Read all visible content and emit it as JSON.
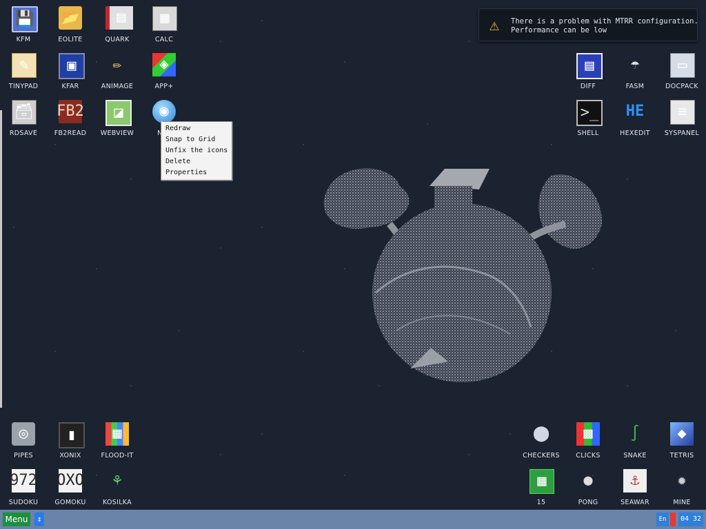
{
  "desktop": {
    "icons": [
      {
        "label": "KFM",
        "glyph": "💾"
      },
      {
        "label": "EOLITE",
        "glyph": "📂"
      },
      {
        "label": "QUARK",
        "glyph": "▤"
      },
      {
        "label": "CALC",
        "glyph": "▦"
      },
      {
        "label": "TINYPAD",
        "glyph": "✎"
      },
      {
        "label": "KFAR",
        "glyph": "▣"
      },
      {
        "label": "ANIMAGE",
        "glyph": "✏"
      },
      {
        "label": "APP+",
        "glyph": "◈"
      },
      {
        "label": "RDSAVE",
        "glyph": "🗃"
      },
      {
        "label": "FB2READ",
        "glyph": "FB2"
      },
      {
        "label": "WEBVIEW",
        "glyph": "◪"
      },
      {
        "label": "NET",
        "glyph": "◉"
      },
      {
        "label": "DIFF",
        "glyph": "▤"
      },
      {
        "label": "FASM",
        "glyph": "☂"
      },
      {
        "label": "DOCPACK",
        "glyph": "▭"
      },
      {
        "label": "SHELL",
        "glyph": ">_"
      },
      {
        "label": "HEXEDIT",
        "glyph": "HE"
      },
      {
        "label": "SYSPANEL",
        "glyph": "≡"
      },
      {
        "label": "PIPES",
        "glyph": "◎"
      },
      {
        "label": "XONIX",
        "glyph": "▮"
      },
      {
        "label": "FLOOD-IT",
        "glyph": "▦"
      },
      {
        "label": "CHECKERS",
        "glyph": "⬤"
      },
      {
        "label": "CLICKS",
        "glyph": "▩"
      },
      {
        "label": "SNAKE",
        "glyph": "∫"
      },
      {
        "label": "TETRIS",
        "glyph": "◆"
      },
      {
        "label": "SUDOKU",
        "glyph": "972"
      },
      {
        "label": "GOMOKU",
        "glyph": "OXO"
      },
      {
        "label": "KOSILKA",
        "glyph": "⚘"
      },
      {
        "label": "15",
        "glyph": "▦"
      },
      {
        "label": "PONG",
        "glyph": "●"
      },
      {
        "label": "SEAWAR",
        "glyph": "⚓"
      },
      {
        "label": "MINE",
        "glyph": "✹"
      }
    ],
    "wallpaper": "planet-illustration"
  },
  "notification": {
    "line1": "There is a problem with MTRR configuration.",
    "line2": "Performance can be low",
    "icon": "warning-icon"
  },
  "context_menu": {
    "items": [
      "Redraw",
      "Snap to Grid",
      "Unfix the icons",
      "Delete",
      "Properties"
    ]
  },
  "taskbar": {
    "menu_label": "Menu",
    "arrow_glyph": "↕",
    "language": "En",
    "clock": "04 32",
    "accent": "#1e8f3f"
  }
}
